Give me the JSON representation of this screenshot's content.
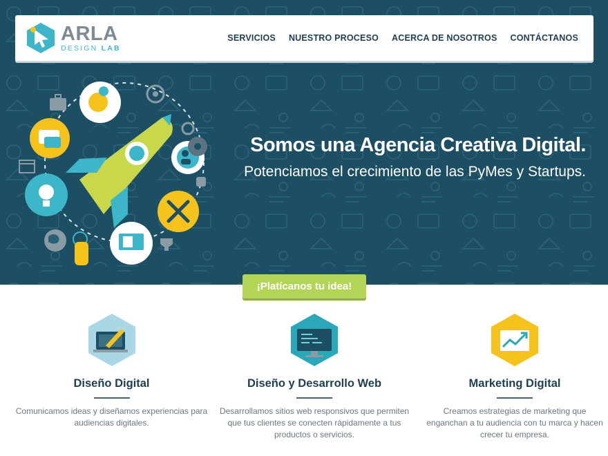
{
  "brand": {
    "name": "ARLA",
    "sub_design": "DESIGN",
    "sub_lab": "LAB"
  },
  "nav": {
    "items": [
      {
        "label": "SERVICIOS"
      },
      {
        "label": "NUESTRO PROCESO"
      },
      {
        "label": "ACERCA DE NOSOTROS"
      },
      {
        "label": "CONTÁCTANOS"
      }
    ]
  },
  "hero": {
    "title": "Somos una Agencia Creativa Digital.",
    "subtitle": "Potenciamos el crecimiento de las PyMes y Startups.",
    "illustration_icons": [
      "rocket-icon",
      "thinking-head-icon",
      "chat-bubble-icon",
      "user-group-icon",
      "lightbulb-icon",
      "tools-icon",
      "globe-icon",
      "tap-hand-icon",
      "document-screen-icon",
      "briefcase-icon",
      "target-icon",
      "gear-icon",
      "thumbs-up-icon",
      "trophy-icon",
      "browser-window-icon"
    ]
  },
  "cta": {
    "label": "¡Platícanos tu idea!"
  },
  "services": [
    {
      "title": "Diseño Digital",
      "description": "Comunicamos ideas y diseñamos experiencias para audiencias digitales.",
      "icon": "pen-tablet-icon"
    },
    {
      "title": "Diseño y Desarrollo Web",
      "description": "Desarrollamos sitios web responsivos que permiten que tus clientes se conecten rápidamente a tus productos o servicios.",
      "icon": "code-monitor-icon"
    },
    {
      "title": "Marketing Digital",
      "description": "Creamos estrategias de marketing que enganchan a tu audiencia con tu marca y hacen crecer tu empresa.",
      "icon": "growth-chart-icon"
    }
  ],
  "colors": {
    "hero_bg": "#1d4f64",
    "nav_text": "#1f3f50",
    "accent_teal": "#3cb6c8",
    "cta_green": "#b3d457",
    "accent_yellow": "#f6c21c"
  }
}
